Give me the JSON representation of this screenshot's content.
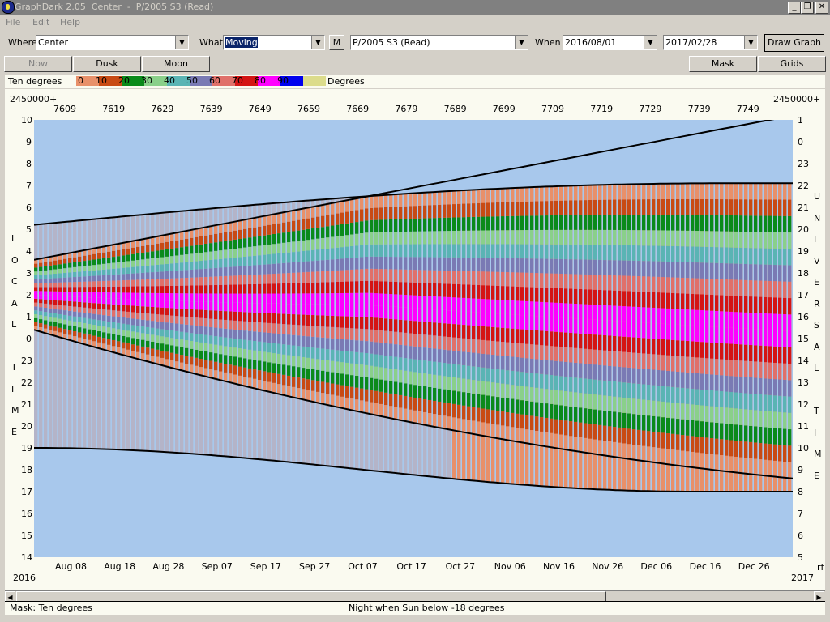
{
  "window": {
    "title": "GraphDark 2.05  Center  -  P/2005 S3 (Read)"
  },
  "menu": {
    "file": "File",
    "edit": "Edit",
    "help": "Help"
  },
  "toolbar": {
    "where_label": "Where",
    "where_value": "Center",
    "what_label": "What",
    "what_value": "Moving",
    "m_button": "M",
    "object_value": "P/2005 S3 (Read)",
    "when_label": "When",
    "start_date": "2016/08/01",
    "end_date": "2017/02/28",
    "draw_button": "Draw Graph"
  },
  "buttons": {
    "now": "Now",
    "dusk": "Dusk",
    "moon": "Moon",
    "mask": "Mask",
    "grids": "Grids"
  },
  "legend": {
    "label": "Ten degrees",
    "unit": "Degrees",
    "entries": [
      {
        "text": "0",
        "color": "#e8906a"
      },
      {
        "text": "10",
        "color": "#c84a14"
      },
      {
        "text": "20",
        "color": "#0a8a1a"
      },
      {
        "text": "30",
        "color": "#8ad08a"
      },
      {
        "text": "40",
        "color": "#5ab4b4"
      },
      {
        "text": "50",
        "color": "#7a7ab4"
      },
      {
        "text": "60",
        "color": "#e0706a"
      },
      {
        "text": "70",
        "color": "#d41414"
      },
      {
        "text": "80",
        "color": "#ff00ff"
      },
      {
        "text": "90",
        "color": "#0000ee"
      },
      {
        "text": "",
        "color": "#dcdc8c"
      }
    ]
  },
  "chart_data": {
    "type": "heatmap",
    "top_axis_label_left": "2450000+",
    "top_axis_label_right": "2450000+",
    "top_ticks": [
      "7609",
      "7619",
      "7629",
      "7639",
      "7649",
      "7659",
      "7669",
      "7679",
      "7689",
      "7699",
      "7709",
      "7719",
      "7729",
      "7739",
      "7749"
    ],
    "bottom_ticks": [
      "Aug 08",
      "Aug 18",
      "Aug 28",
      "Sep 07",
      "Sep 17",
      "Sep 27",
      "Oct 07",
      "Oct 17",
      "Oct 27",
      "Nov 06",
      "Nov 16",
      "Nov 26",
      "Dec 06",
      "Dec 16",
      "Dec 26"
    ],
    "year_left": "2016",
    "year_right": "2017",
    "year_right_suffix": "rf",
    "left_ticks": [
      "10",
      "9",
      "8",
      "7",
      "6",
      "5",
      "4",
      "3",
      "2",
      "1",
      "0",
      "23",
      "22",
      "21",
      "20",
      "19",
      "18",
      "17",
      "16",
      "15",
      "14"
    ],
    "right_ticks": [
      "1",
      "0",
      "23",
      "22",
      "21",
      "20",
      "19",
      "18",
      "17",
      "16",
      "15",
      "14",
      "13",
      "12",
      "11",
      "10",
      "9",
      "8",
      "7",
      "6",
      "5"
    ],
    "left_axis_letters": [
      "L",
      "O",
      "C",
      "A",
      "L",
      "",
      "T",
      "I",
      "M",
      "E"
    ],
    "right_axis_letters": [
      "U",
      "N",
      "I",
      "V",
      "E",
      "R",
      "S",
      "A",
      "L",
      "",
      "T",
      "I",
      "M",
      "E"
    ],
    "x_range": [
      "2016/08/01",
      "2017/02/28"
    ],
    "y_range_local_hours": [
      14,
      34
    ],
    "night_start_local": [
      19.0,
      17.0
    ],
    "night_end_local": [
      29.2,
      31.1
    ],
    "colors": {
      "sky": "#a8c8ec",
      "night": "#0a0a3c",
      "twilight": "#0a80c8",
      "grey": "#b4b4c8"
    }
  },
  "status": {
    "mask": "Mask:  Ten degrees",
    "night": "Night when Sun below -18 degrees"
  }
}
